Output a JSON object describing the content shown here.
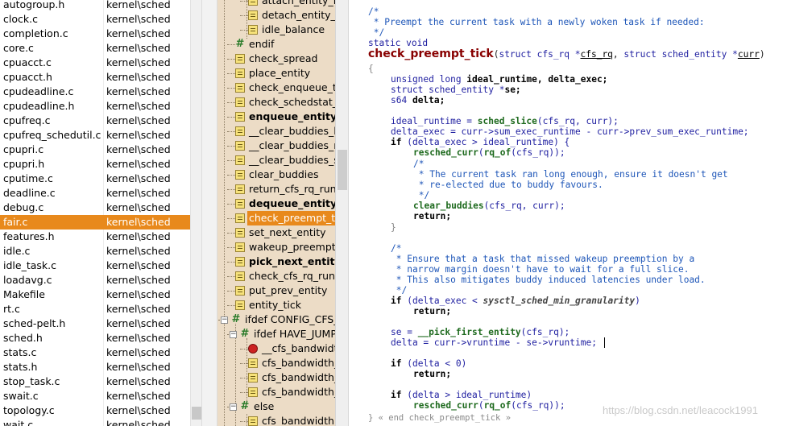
{
  "file_list": {
    "rows": [
      {
        "name": "autogroup.h",
        "dir": "kernel\\sched"
      },
      {
        "name": "clock.c",
        "dir": "kernel\\sched"
      },
      {
        "name": "completion.c",
        "dir": "kernel\\sched"
      },
      {
        "name": "core.c",
        "dir": "kernel\\sched"
      },
      {
        "name": "cpuacct.c",
        "dir": "kernel\\sched"
      },
      {
        "name": "cpuacct.h",
        "dir": "kernel\\sched"
      },
      {
        "name": "cpudeadline.c",
        "dir": "kernel\\sched"
      },
      {
        "name": "cpudeadline.h",
        "dir": "kernel\\sched"
      },
      {
        "name": "cpufreq.c",
        "dir": "kernel\\sched"
      },
      {
        "name": "cpufreq_schedutil.c",
        "dir": "kernel\\sched"
      },
      {
        "name": "cpupri.c",
        "dir": "kernel\\sched"
      },
      {
        "name": "cpupri.h",
        "dir": "kernel\\sched"
      },
      {
        "name": "cputime.c",
        "dir": "kernel\\sched"
      },
      {
        "name": "deadline.c",
        "dir": "kernel\\sched"
      },
      {
        "name": "debug.c",
        "dir": "kernel\\sched"
      },
      {
        "name": "fair.c",
        "dir": "kernel\\sched"
      },
      {
        "name": "features.h",
        "dir": "kernel\\sched"
      },
      {
        "name": "idle.c",
        "dir": "kernel\\sched"
      },
      {
        "name": "idle_task.c",
        "dir": "kernel\\sched"
      },
      {
        "name": "loadavg.c",
        "dir": "kernel\\sched"
      },
      {
        "name": "Makefile",
        "dir": "kernel\\sched"
      },
      {
        "name": "rt.c",
        "dir": "kernel\\sched"
      },
      {
        "name": "sched-pelt.h",
        "dir": "kernel\\sched"
      },
      {
        "name": "sched.h",
        "dir": "kernel\\sched"
      },
      {
        "name": "stats.c",
        "dir": "kernel\\sched"
      },
      {
        "name": "stats.h",
        "dir": "kernel\\sched"
      },
      {
        "name": "stop_task.c",
        "dir": "kernel\\sched"
      },
      {
        "name": "swait.c",
        "dir": "kernel\\sched"
      },
      {
        "name": "topology.c",
        "dir": "kernel\\sched"
      },
      {
        "name": "wait.c",
        "dir": "kernel\\sched"
      }
    ],
    "selected": "fair.c"
  },
  "symbols": {
    "rows": [
      {
        "label": "attach_entity_load",
        "icon": "function-icon",
        "bold": false
      },
      {
        "label": "detach_entity_load",
        "icon": "function-icon",
        "bold": false
      },
      {
        "label": "idle_balance",
        "icon": "function-icon",
        "bold": false
      },
      {
        "label": "endif",
        "icon": "preprocessor-icon",
        "bold": false
      },
      {
        "label": "check_spread",
        "icon": "function-icon",
        "bold": false
      },
      {
        "label": "place_entity",
        "icon": "function-icon",
        "bold": false
      },
      {
        "label": "check_enqueue_thro",
        "icon": "function-icon",
        "bold": false
      },
      {
        "label": "check_schedstat_req",
        "icon": "function-icon",
        "bold": false
      },
      {
        "label": "enqueue_entity",
        "icon": "function-icon",
        "bold": true
      },
      {
        "label": "__clear_buddies_last",
        "icon": "function-icon",
        "bold": false
      },
      {
        "label": "__clear_buddies_next",
        "icon": "function-icon",
        "bold": false
      },
      {
        "label": "__clear_buddies_skip",
        "icon": "function-icon",
        "bold": false
      },
      {
        "label": "clear_buddies",
        "icon": "function-icon",
        "bold": false
      },
      {
        "label": "return_cfs_rq_runtim",
        "icon": "function-icon",
        "bold": false
      },
      {
        "label": "dequeue_entity",
        "icon": "function-icon",
        "bold": true
      },
      {
        "label": "check_preempt_tick",
        "icon": "function-icon",
        "bold": false
      },
      {
        "label": "set_next_entity",
        "icon": "function-icon",
        "bold": false
      },
      {
        "label": "wakeup_preempt_en",
        "icon": "function-icon",
        "bold": false
      },
      {
        "label": "pick_next_entity",
        "icon": "function-icon",
        "bold": true
      },
      {
        "label": "check_cfs_rq_runtime",
        "icon": "function-icon",
        "bold": false
      },
      {
        "label": "put_prev_entity",
        "icon": "function-icon",
        "bold": false
      },
      {
        "label": "entity_tick",
        "icon": "function-icon",
        "bold": false
      },
      {
        "label": "ifdef CONFIG_CFS_B",
        "icon": "preprocessor-icon",
        "bold": false
      },
      {
        "label": "ifdef HAVE_JUMP_",
        "icon": "preprocessor-icon",
        "bold": false
      },
      {
        "label": "__cfs_bandwidth",
        "icon": "reference-icon",
        "bold": false
      },
      {
        "label": "cfs_bandwidth_",
        "icon": "function-icon",
        "bold": false
      },
      {
        "label": "cfs_bandwidth_",
        "icon": "function-icon",
        "bold": false
      },
      {
        "label": "cfs_bandwidth_",
        "icon": "function-icon",
        "bold": false
      },
      {
        "label": "else",
        "icon": "preprocessor-icon",
        "bold": false
      },
      {
        "label": "cfs_bandwidth_",
        "icon": "function-icon",
        "bold": false
      }
    ],
    "selected": "check_preempt_tick"
  },
  "code": {
    "c1": "/*",
    "c2": " * Preempt the current task with a newly woken task if needed:",
    "c3": " */",
    "sig_static": "static void",
    "sig_name": "check_preempt_tick",
    "sig_p1": "(",
    "sig_t1": "struct",
    "sig_t1b": " cfs_rq *",
    "sig_a1": "cfs_rq",
    "sig_comma": ", ",
    "sig_t2": "struct",
    "sig_t2b": " sched_entity *",
    "sig_a2": "curr",
    "sig_p2": ")",
    "brace_open": "{",
    "d1_type": "unsigned long ",
    "d1_vars": "ideal_runtime, delta_exec;",
    "d2_type": "struct sched_entity *",
    "d2_var": "se;",
    "d3_type": "s64 ",
    "d3_var": "delta;",
    "l1_lhs": "ideal_runtime = ",
    "l1_fn": "sched_slice",
    "l1_rest": "(cfs_rq, curr);",
    "l2": "delta_exec = curr->sum_exec_runtime - curr->prev_sum_exec_runtime;",
    "if1_kw": "if",
    "if1_rest": " (delta_exec > ideal_runtime) {",
    "r1_fn": "resched_curr",
    "r1_p": "(",
    "r1_fn2": "rq_of",
    "r1_rest": "(cfs_rq));",
    "ic1": "/*",
    "ic2": " * The current task ran long enough, ensure it doesn't get",
    "ic3": " * re-elected due to buddy favours.",
    "ic4": " */",
    "cb_fn": "clear_buddies",
    "cb_rest": "(cfs_rq, curr);",
    "ret1": "return;",
    "close1": "}",
    "bc1": "/*",
    "bc2": " * Ensure that a task that missed wakeup preemption by a",
    "bc3": " * narrow margin doesn't have to wait for a full slice.",
    "bc4": " * This also mitigates buddy induced latencies under load.",
    "bc5": " */",
    "if2_kw": "if",
    "if2_a": " (delta_exec < ",
    "if2_var": "sysctl_sched_min_granularity",
    "if2_b": ")",
    "ret2": "return;",
    "se_lhs": "se = ",
    "se_fn": "__pick_first_entity",
    "se_rest": "(cfs_rq);",
    "dl": "delta = curr->vruntime - se->vruntime;",
    "if3_kw": "if",
    "if3_rest": " (delta < 0)",
    "ret3": "return;",
    "if4_kw": "if",
    "if4_rest": " (delta > ideal_runtime)",
    "r2_fn": "resched_curr",
    "r2_p": "(",
    "r2_fn2": "rq_of",
    "r2_rest": "(cfs_rq));",
    "end_brace": "}",
    "end_comment": " « end check_preempt_tick »"
  },
  "watermark": "https://blog.csdn.net/leacock1991"
}
